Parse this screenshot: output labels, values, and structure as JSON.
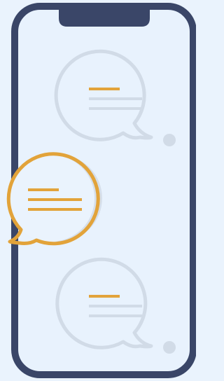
{
  "illustration": {
    "colors": {
      "background": "#eaf3fd",
      "phone_frame": "#3a4668",
      "screen": "#e8f2fd",
      "bubble_faded": "#d1dbe7",
      "accent": "#e2a33a",
      "bubble_shadow": "#d6dfea",
      "indicator_dot": "#d1dbe7"
    },
    "icons": {
      "phone": "smartphone-icon",
      "bubble_top": "chat-bubble-icon",
      "bubble_active": "chat-bubble-icon",
      "bubble_bottom": "chat-bubble-icon"
    }
  }
}
